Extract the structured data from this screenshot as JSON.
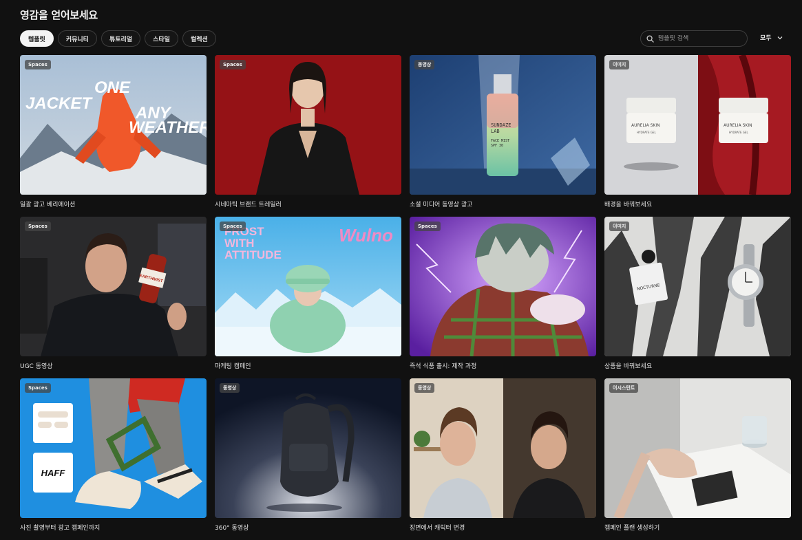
{
  "header": {
    "title": "영감을 얻어보세요"
  },
  "tabs": [
    {
      "label": "템플릿",
      "active": true
    },
    {
      "label": "커뮤니티",
      "active": false
    },
    {
      "label": "튜토리얼",
      "active": false
    },
    {
      "label": "스타일",
      "active": false
    },
    {
      "label": "컬렉션",
      "active": false
    }
  ],
  "search": {
    "placeholder": "템플릿 검색",
    "icon": "search-icon"
  },
  "filter": {
    "label": "모두",
    "icon": "chevron-down-icon"
  },
  "cards": [
    {
      "badge": "Spaces",
      "title": "일괄 광고 베리에이션",
      "overlay": [
        "ONE",
        "JACKET",
        "ANY",
        "WEATHER"
      ]
    },
    {
      "badge": "Spaces",
      "title": "시네마틱 브랜드 트레일러"
    },
    {
      "badge": "동영상",
      "title": "소셜 미디어 동영상 광고",
      "overlay": [
        "SUNDAZE",
        "LAB",
        "FACE MIST",
        "SPF 30"
      ]
    },
    {
      "badge": "이미지",
      "title": "배경을 바꿔보세요",
      "overlay": [
        "AURELIA SKIN",
        "HYDRATE GEL"
      ]
    },
    {
      "badge": "Spaces",
      "title": "UGC 동영상",
      "overlay": [
        "EARTHMIST"
      ]
    },
    {
      "badge": "Spaces",
      "title": "마케팅 캠페인",
      "overlay": [
        "FROST",
        "WITH",
        "ATTITUDE",
        "Wulno"
      ]
    },
    {
      "badge": "Spaces",
      "title": "즉석 식품 출시: 제작 과정"
    },
    {
      "badge": "이미지",
      "title": "상품을 바꿔보세요",
      "overlay": [
        "NOCTURNE"
      ]
    },
    {
      "badge": "Spaces",
      "title": "사진 촬영부터 광고 캠페인까지",
      "overlay": [
        "HAFF"
      ]
    },
    {
      "badge": "동영상",
      "title": "360° 동영상"
    },
    {
      "badge": "동영상",
      "title": "장면에서 캐릭터 변경"
    },
    {
      "badge": "어시스턴트",
      "title": "캠페인 플랜 생성하기"
    }
  ]
}
